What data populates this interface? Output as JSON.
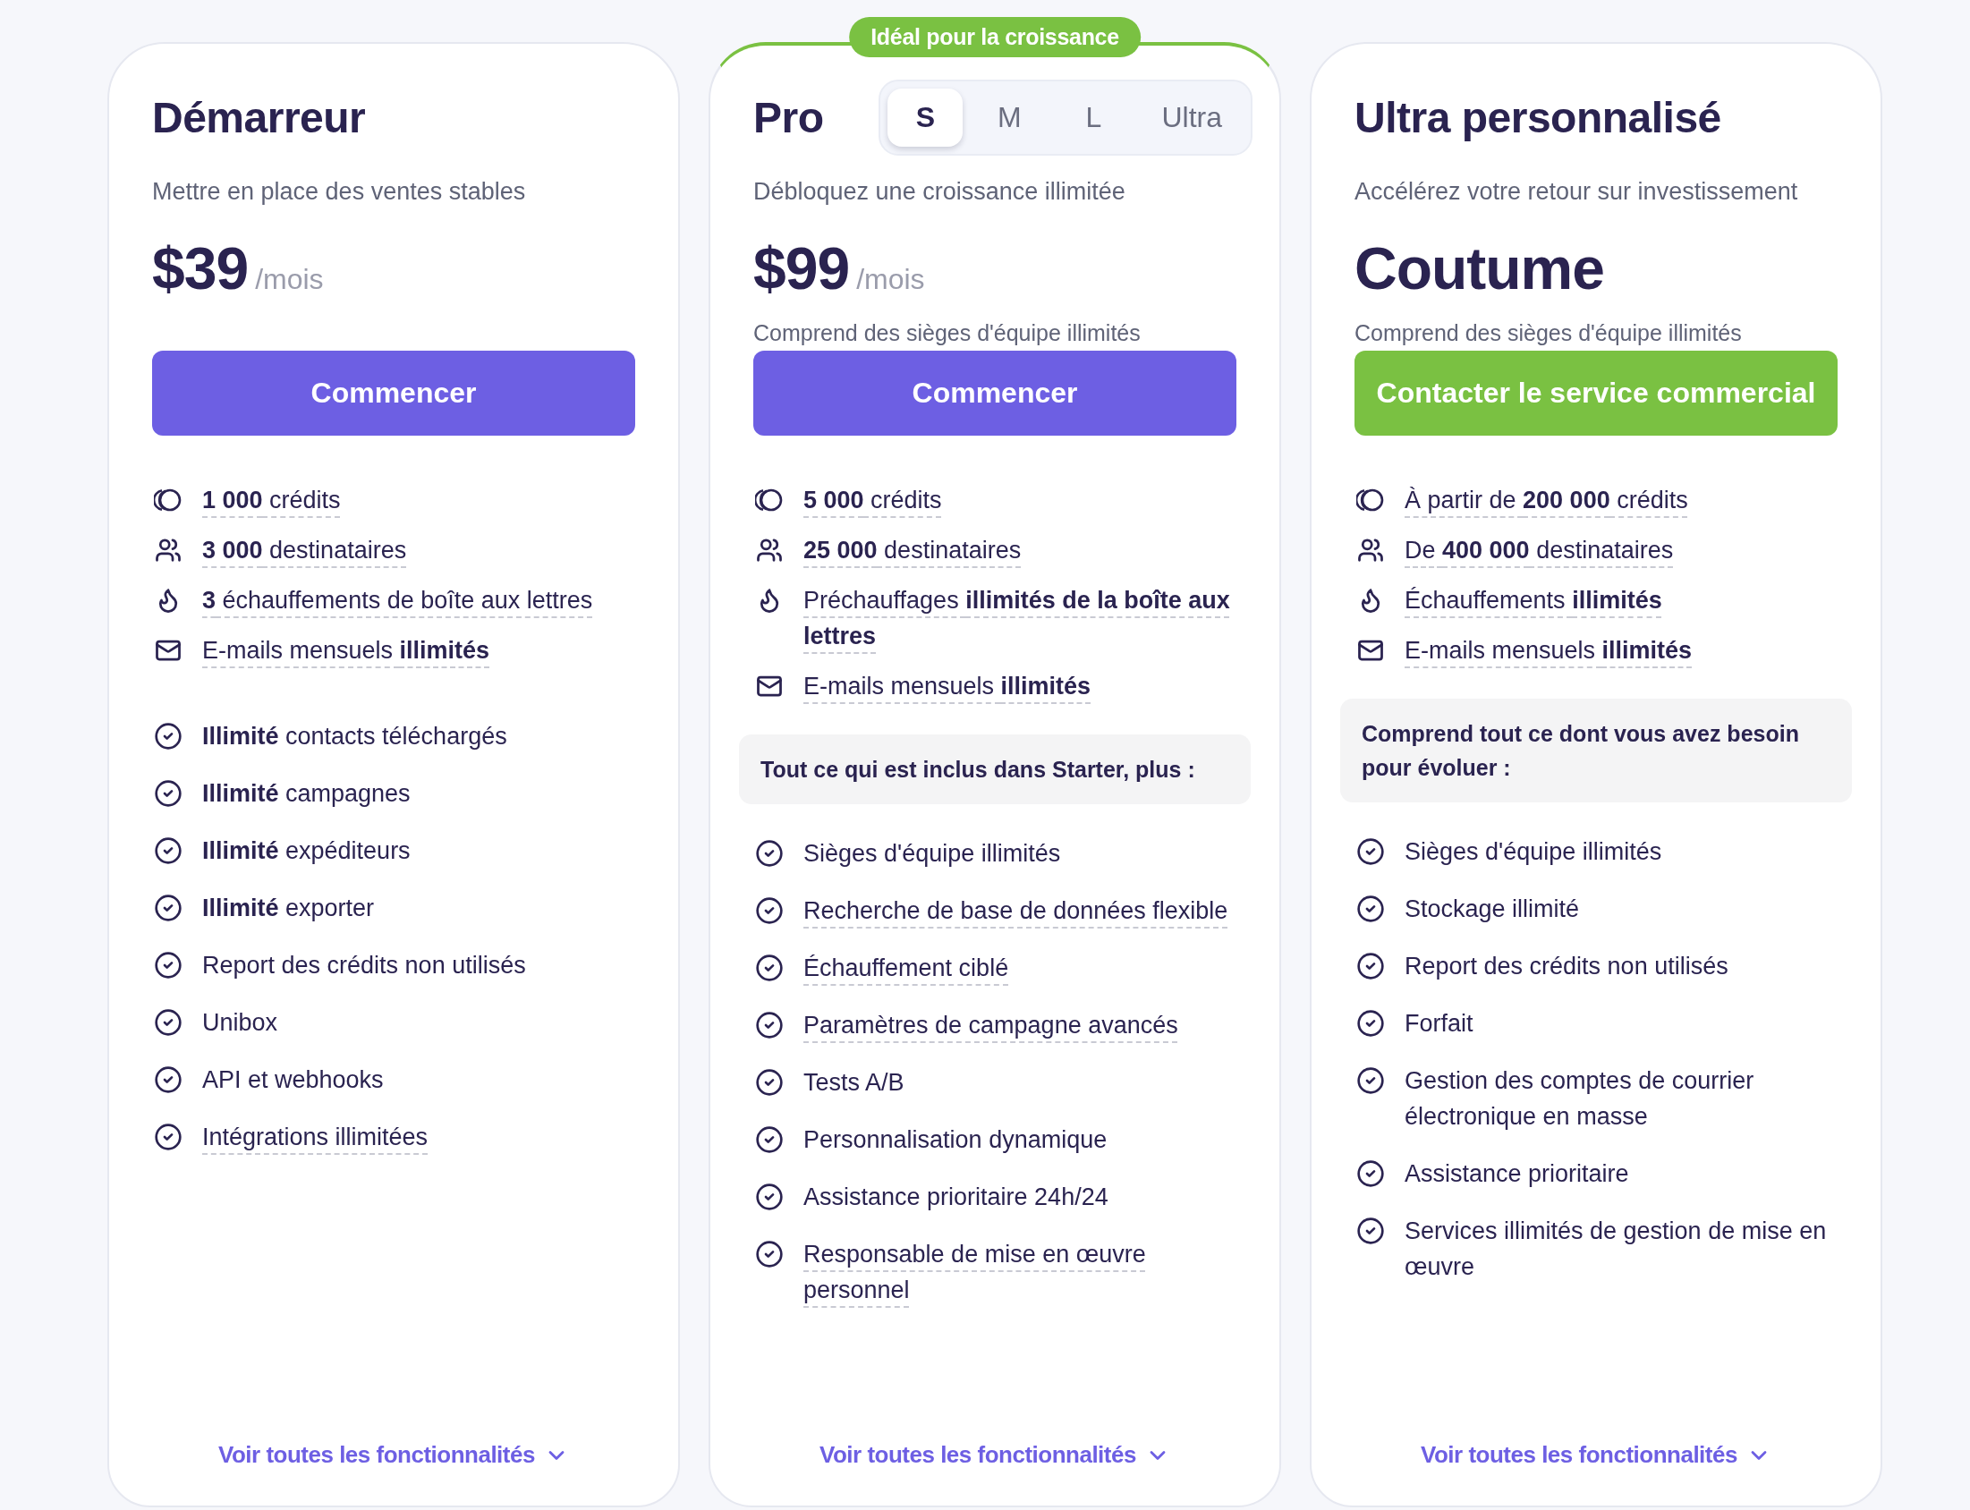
{
  "plans": [
    {
      "name": "Démarreur",
      "highlighted": false,
      "subtitle": "Mettre en place des ventes stables",
      "price": "$39",
      "period": "/mois",
      "button": {
        "label": "Commencer",
        "color": "#6d5fe3"
      },
      "quotas": [
        {
          "kind": "credits",
          "text": "**1 000** crédits"
        },
        {
          "kind": "recipients",
          "text": "**3 000** destinataires"
        },
        {
          "kind": "warmup",
          "text": "**3** échauffements de boîte aux lettres"
        },
        {
          "kind": "emails",
          "text": "E-mails mensuels **illimités**"
        }
      ],
      "features": [
        {
          "text": "**Illimité** contacts téléchargés",
          "underlined": false
        },
        {
          "text": "**Illimité** campagnes",
          "underlined": false
        },
        {
          "text": "**Illimité** expéditeurs",
          "underlined": false
        },
        {
          "text": "**Illimité** exporter",
          "underlined": false
        },
        {
          "text": "Report des crédits non utilisés",
          "underlined": false
        },
        {
          "text": "Unibox",
          "underlined": false
        },
        {
          "text": "API et webhooks",
          "underlined": false
        },
        {
          "text": "Intégrations illimitées",
          "underlined": true
        }
      ],
      "footer": "Voir toutes les fonctionnalités"
    },
    {
      "name": "Pro",
      "highlighted": true,
      "badge": "Idéal pour la croissance",
      "sizes": [
        {
          "label": "S",
          "selected": true
        },
        {
          "label": "M",
          "selected": false
        },
        {
          "label": "L",
          "selected": false
        },
        {
          "label": "Ultra",
          "selected": false
        }
      ],
      "subtitle": "Débloquez une croissance illimitée",
      "price": "$99",
      "period": "/mois",
      "note": "Comprend des sièges d'équipe illimités",
      "button": {
        "label": "Commencer",
        "color": "#6d5fe3"
      },
      "quotas": [
        {
          "kind": "credits",
          "text": "**5 000** crédits"
        },
        {
          "kind": "recipients",
          "text": "**25 000** destinataires"
        },
        {
          "kind": "warmup",
          "text": "Préchauffages **illimités de la boîte aux lettres**"
        },
        {
          "kind": "emails",
          "text": "E-mails mensuels **illimités**"
        }
      ],
      "included_heading": "Tout ce qui est inclus dans Starter, plus :",
      "features": [
        {
          "text": "Sièges d'équipe illimités",
          "underlined": false
        },
        {
          "text": "Recherche de base de données flexible",
          "underlined": true
        },
        {
          "text": "Échauffement ciblé",
          "underlined": true
        },
        {
          "text": "Paramètres de campagne avancés",
          "underlined": true
        },
        {
          "text": "Tests A/B",
          "underlined": false
        },
        {
          "text": "Personnalisation dynamique",
          "underlined": false
        },
        {
          "text": "Assistance prioritaire 24h/24",
          "underlined": false
        },
        {
          "text": "Responsable de mise en œuvre personnel",
          "underlined": true
        }
      ],
      "footer": "Voir toutes les fonctionnalités"
    },
    {
      "name": "Ultra personnalisé",
      "highlighted": false,
      "subtitle": "Accélérez votre retour sur investissement",
      "price": "Coutume",
      "note": "Comprend des sièges d'équipe illimités",
      "button": {
        "label": "Contacter le service commercial",
        "color": "#7ac142"
      },
      "quotas": [
        {
          "kind": "credits",
          "text": "À partir de **200 000** crédits"
        },
        {
          "kind": "recipients",
          "text": "De **400 000** destinataires"
        },
        {
          "kind": "warmup",
          "text": "Échauffements **illimités**"
        },
        {
          "kind": "emails",
          "text": "E-mails mensuels **illimités**"
        }
      ],
      "included_heading": "Comprend tout ce dont vous avez besoin pour évoluer :",
      "features": [
        {
          "text": "Sièges d'équipe illimités",
          "underlined": false
        },
        {
          "text": "Stockage illimité",
          "underlined": false
        },
        {
          "text": "Report des crédits non utilisés",
          "underlined": false
        },
        {
          "text": "Forfait",
          "underlined": false
        },
        {
          "text": "Gestion des comptes de courrier électronique en masse",
          "underlined": false
        },
        {
          "text": "Assistance prioritaire",
          "underlined": false
        },
        {
          "text": "Services illimités de gestion de mise en œuvre",
          "underlined": false
        }
      ],
      "footer": "Voir toutes les fonctionnalités"
    }
  ]
}
